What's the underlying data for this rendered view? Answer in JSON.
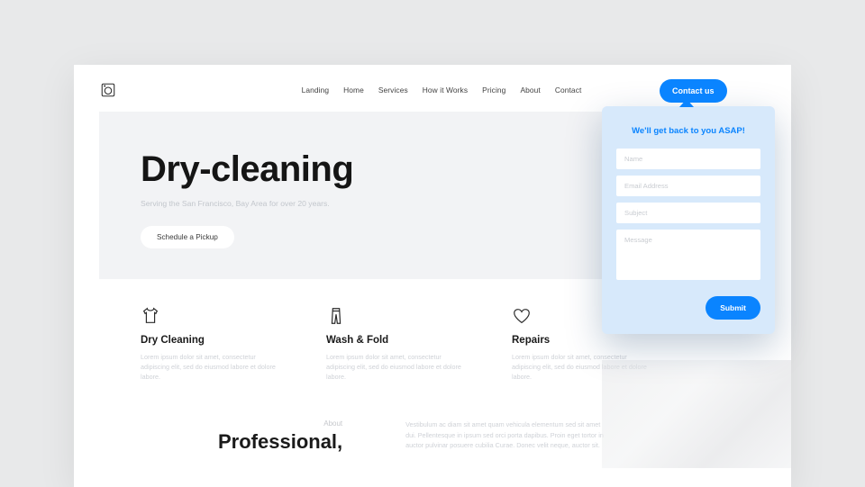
{
  "nav": {
    "items": [
      "Landing",
      "Home",
      "Services",
      "How it Works",
      "Pricing",
      "About",
      "Contact"
    ]
  },
  "hero": {
    "title": "Dry-cleaning",
    "subtitle": "Serving the San Francisco, Bay Area for over 20 years.",
    "cta": "Schedule a Pickup"
  },
  "services": [
    {
      "title": "Dry Cleaning",
      "desc": "Lorem ipsum dolor sit amet, consectetur adipiscing elit, sed do eiusmod labore et dolore labore."
    },
    {
      "title": "Wash & Fold",
      "desc": "Lorem ipsum dolor sit amet, consectetur adipiscing elit, sed do eiusmod labore et dolore labore."
    },
    {
      "title": "Repairs",
      "desc": "Lorem ipsum dolor sit amet, consectetur adipiscing elit, sed do eiusmod labore et dolore labore."
    }
  ],
  "about": {
    "label": "About",
    "title": "Professional,",
    "text": "Vestibulum ac diam sit amet quam vehicula elementum sed sit amet dui. Pellentesque in ipsum sed orci porta dapibus. Proin eget tortor in auctor pulvinar posuere cubilia Curae. Donec velit neque, auctor sit."
  },
  "contact": {
    "button": "Contact us",
    "popup_title": "We'll get back to you ASAP!",
    "placeholders": {
      "name": "Name",
      "email": "Email Address",
      "subject": "Subject",
      "message": "Message"
    },
    "submit": "Submit"
  }
}
